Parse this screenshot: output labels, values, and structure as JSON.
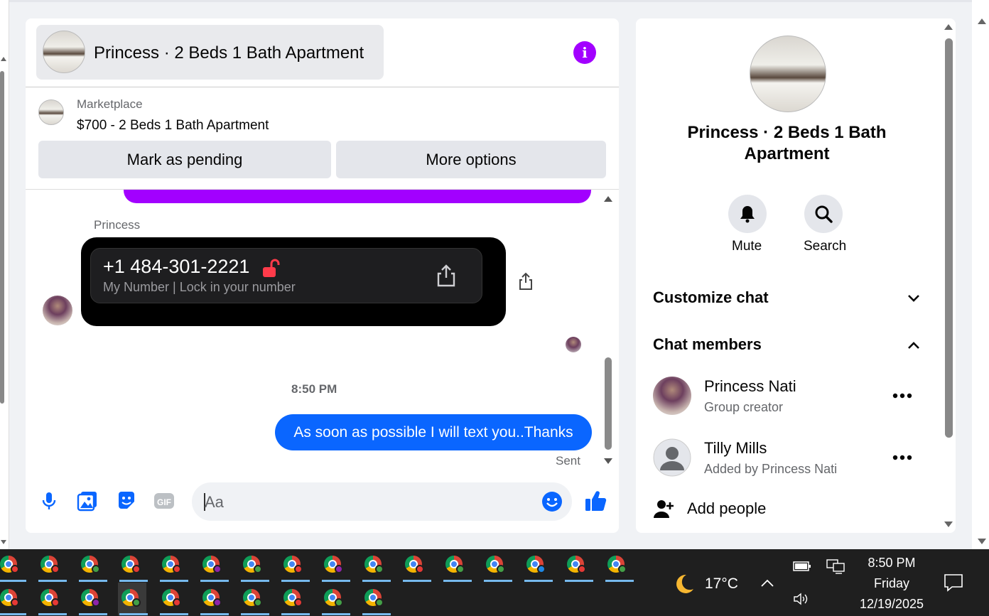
{
  "chat": {
    "title": "Princess · 2 Beds 1 Bath Apartment",
    "info_icon": "info-icon",
    "marketplace_label": "Marketplace",
    "listing_title": "$700 - 2 Beds 1 Bath Apartment",
    "mark_pending_label": "Mark as pending",
    "more_options_label": "More options",
    "messages": {
      "sender_name": "Princess",
      "phone_number": "+1 484-301-2221",
      "phone_subtitle": "My Number | Lock in your number",
      "timestamp": "8:50 PM",
      "my_message": "As soon as possible I will text you..Thanks",
      "status": "Sent"
    },
    "composer": {
      "placeholder": "Aa",
      "icons": [
        "microphone-icon",
        "gallery-icon",
        "sticker-icon",
        "gif-icon",
        "emoji-icon",
        "thumbs-up-icon"
      ],
      "gif_text": "GIF"
    }
  },
  "info_panel": {
    "title": "Princess · 2 Beds 1 Bath Apartment",
    "mute_label": "Mute",
    "search_label": "Search",
    "customize_chat": "Customize chat",
    "chat_members": "Chat members",
    "members": [
      {
        "name": "Princess Nati",
        "role": "Group creator"
      },
      {
        "name": "Tilly Mills",
        "role": "Added by Princess Nati"
      }
    ],
    "add_people": "Add people"
  },
  "taskbar": {
    "temperature": "17°C",
    "time": "8:50 PM",
    "day": "Friday",
    "date": "12/19/2025"
  },
  "colors": {
    "accent_purple": "#a200ff",
    "accent_blue": "#0a66ff",
    "taskbar": "#1f1f1f"
  }
}
